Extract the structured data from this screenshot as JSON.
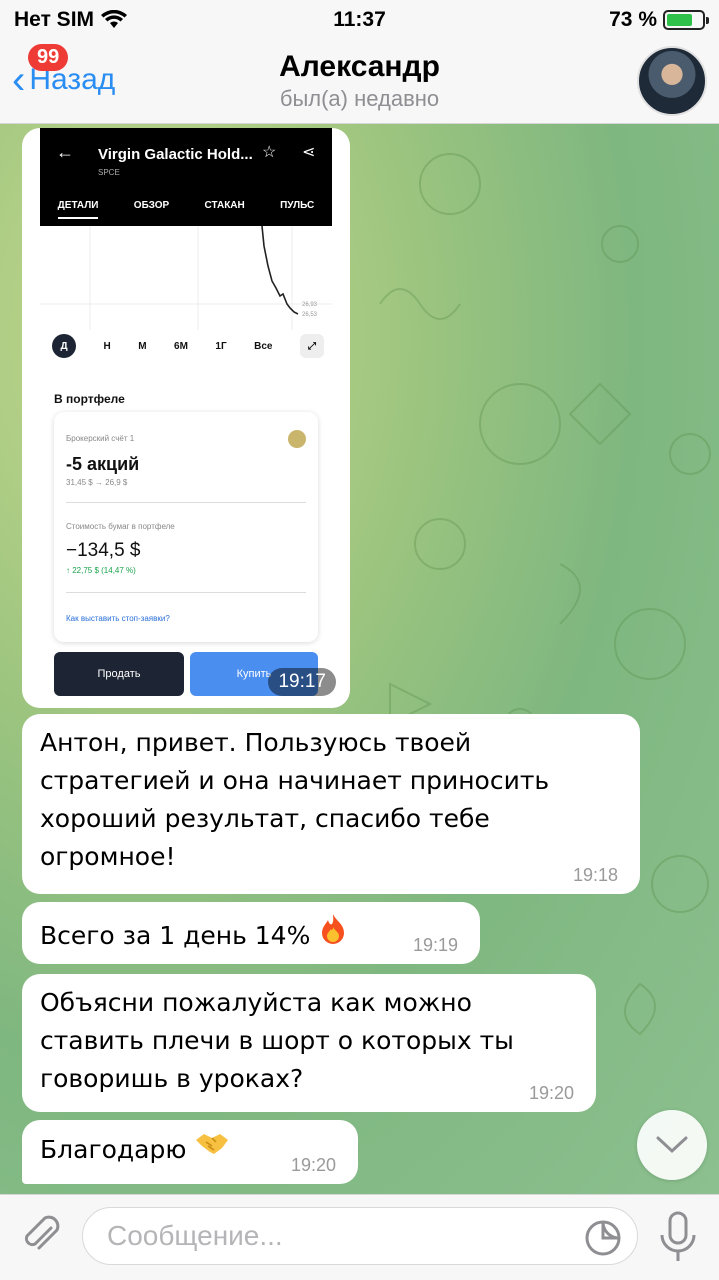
{
  "status_bar": {
    "carrier": "Нет SIM",
    "time": "11:37",
    "battery_percent": "73 %",
    "battery_level": 0.73
  },
  "header": {
    "back_label": "Назад",
    "unread_badge": "99",
    "contact_name": "Александр",
    "contact_status": "был(а) недавно"
  },
  "photo_message": {
    "time": "19:17",
    "screenshot": {
      "title": "Virgin Galactic Hold...",
      "ticker": "SPCE",
      "tabs": [
        "ДЕТАЛИ",
        "ОБЗОР",
        "СТАКАН",
        "ПУЛЬС"
      ],
      "active_tab": "ДЕТАЛИ",
      "chart_labels": [
        "26,93",
        "26,53"
      ],
      "periods": [
        "Д",
        "Н",
        "М",
        "6М",
        "1Г",
        "Все"
      ],
      "active_period": "Д",
      "portfolio_title": "В портфеле",
      "account_label": "Брокерский счёт 1",
      "shares": "-5 акций",
      "prices": "31,45 $ → 26,9 $",
      "value_label": "Стоимость бумаг в портфеле",
      "value": "−134,5 $",
      "change": "↑ 22,75 $ (14,47 %)",
      "stop_link": "Как выставить стоп-заявки?",
      "sell_label": "Продать",
      "buy_label": "Купить"
    }
  },
  "messages": [
    {
      "text": "Антон, привет. Пользуюсь твоей стратегией и она начинает приносить хороший результат, спасибо тебе огромное!",
      "time": "19:18"
    },
    {
      "text": "Всего за 1 день 14%",
      "emoji": "fire",
      "time": "19:19"
    },
    {
      "text": "Объясни пожалуйста как можно ставить плечи в шорт о которых ты говоришь в уроках?",
      "time": "19:20"
    },
    {
      "text": "Благодарю",
      "emoji": "handshake",
      "time": "19:20"
    }
  ],
  "input": {
    "placeholder": "Сообщение..."
  }
}
